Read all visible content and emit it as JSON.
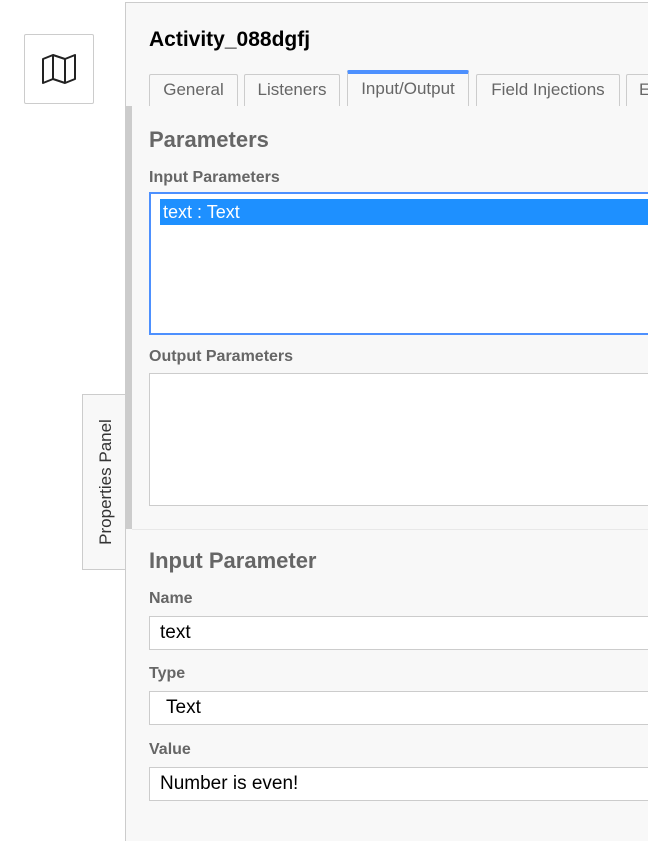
{
  "canvas": {
    "map_button_icon": "map-icon"
  },
  "panel_toggle": {
    "label": "Properties Panel"
  },
  "panel": {
    "title": "Activity_088dgfj",
    "tabs": [
      {
        "label": "General",
        "active": false
      },
      {
        "label": "Listeners",
        "active": false
      },
      {
        "label": "Input/Output",
        "active": true
      },
      {
        "label": "Field Injections",
        "active": false
      },
      {
        "label": "E",
        "active": false
      }
    ],
    "parameters": {
      "heading": "Parameters",
      "input_label": "Input Parameters",
      "input_items": [
        "text : Text"
      ],
      "output_label": "Output Parameters",
      "output_items": []
    },
    "input_parameter": {
      "heading": "Input Parameter",
      "name_label": "Name",
      "name_value": "text",
      "type_label": "Type",
      "type_value": "Text",
      "value_label": "Value",
      "value_value": "Number is even!"
    }
  },
  "colors": {
    "accent": "#4d90fe",
    "selection": "#1e90ff"
  }
}
